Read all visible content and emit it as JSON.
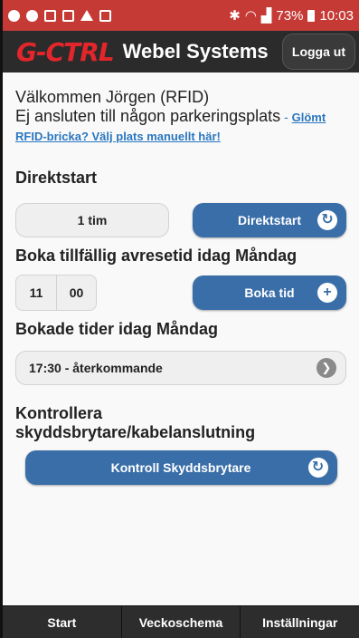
{
  "status_bar": {
    "bluetooth_icon": "bluetooth-icon",
    "signal_icon": "signal-icon",
    "battery_percent": "73%",
    "time": "10:03"
  },
  "header": {
    "logo_text": "G-CTRL",
    "title": "Webel Systems",
    "logout_label": "Logga ut"
  },
  "main": {
    "welcome": "Välkommen Jörgen (RFID)",
    "not_connected": "Ej ansluten till någon parkeringsplats",
    "separator": " - ",
    "forgot_link_part1": "Glömt",
    "forgot_link_part2": "RFID-bricka? Välj plats manuellt här!",
    "direktstart": {
      "heading": "Direktstart",
      "duration": "1 tim",
      "button_label": "Direktstart"
    },
    "boka": {
      "heading": "Boka tillfällig avresetid idag Måndag",
      "hour": "11",
      "minute": "00",
      "button_label": "Boka tid"
    },
    "bokade": {
      "heading": "Bokade tider idag Måndag",
      "item": "17:30 - återkommande"
    },
    "kontroll": {
      "heading": "Kontrollera skyddsbrytare/kabelanslutning",
      "button_label": "Kontroll Skyddsbrytare"
    }
  },
  "bottom_nav": {
    "items": [
      "Start",
      "Veckoschema",
      "Inställningar"
    ]
  },
  "colors": {
    "status_bar": "#c63a36",
    "app_bar": "#2b2b2b",
    "logo": "#e3262b",
    "primary_button": "#3a6ea8",
    "link": "#2a77c0"
  }
}
